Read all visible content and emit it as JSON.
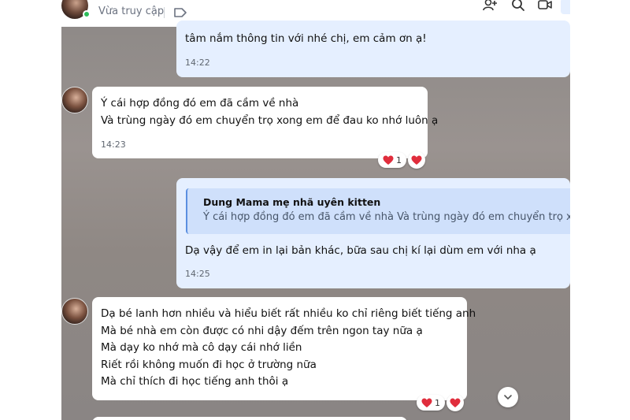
{
  "header": {
    "status": "Vừa truy cập"
  },
  "messages": [
    {
      "lines": [
        "tâm nắm thông tin với nhé chị, em cảm ơn ạ!"
      ],
      "time": "14:22"
    },
    {
      "lines": [
        "Ý cái hợp đồng đó em đã cầm về nhà",
        "Và trùng ngày đó em chuyển trọ xong em để đau ko nhớ luôn ạ"
      ],
      "time": "14:23",
      "reaction_count": "1"
    },
    {
      "quote_name": "Dung Mama mẹ nhã uyên kitten",
      "quote_text": "Ý cái hợp đồng đó em đã cầm về nhà Và trùng ngày đó em chuyển trọ xong ...",
      "lines": [
        "Dạ vậy để em in lại bản khác, bữa sau chị kí lại dùm em với nha ạ"
      ],
      "time": "14:25"
    },
    {
      "lines": [
        "Dạ bé lanh hơn nhiều và hiểu biết rất nhiều  ko chỉ riêng biết tiếng anh",
        "Mà bé nhà em còn được có nhi dậy đếm trên ngon tay nữa ạ",
        "Mà dạy ko nhớ mà cô dạy cái nhớ liền",
        "Riết rồi không muốn đi học ở trường nữa",
        "Mà chỉ thích đi học tiếng anh thôi ạ"
      ],
      "reaction_count": "1"
    }
  ],
  "icons": {
    "heart_color": "#e02d3c",
    "online_color": "#2dbd5a"
  }
}
